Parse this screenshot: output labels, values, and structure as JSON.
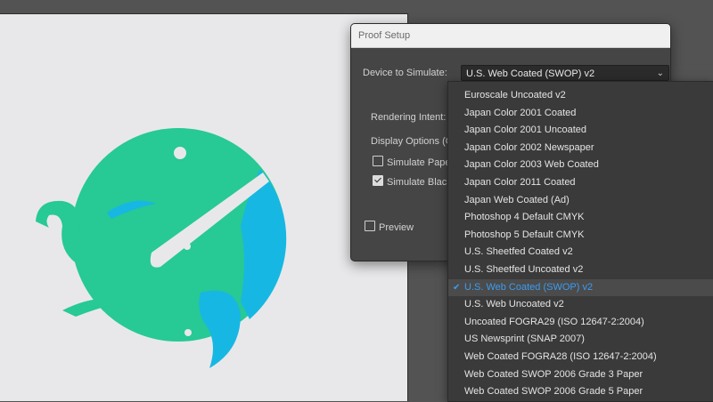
{
  "dialog": {
    "title": "Proof Setup",
    "device_label": "Device to Simulate:",
    "device_value": "U.S. Web Coated (SWOP) v2",
    "rendering_intent_label": "Rendering Intent:",
    "display_options_label": "Display Options (C",
    "simulate_paper_label": "Simulate Paper",
    "simulate_black_label": "Simulate Black",
    "simulate_paper_checked": false,
    "simulate_black_checked": true,
    "preview_label": "Preview",
    "preview_checked": false
  },
  "dropdown": {
    "selected_index": 11,
    "options": [
      "Euroscale Uncoated v2",
      "Japan Color 2001 Coated",
      "Japan Color 2001 Uncoated",
      "Japan Color 2002 Newspaper",
      "Japan Color 2003 Web Coated",
      "Japan Color 2011 Coated",
      "Japan Web Coated (Ad)",
      "Photoshop 4 Default CMYK",
      "Photoshop 5 Default CMYK",
      "U.S. Sheetfed Coated v2",
      "U.S. Sheetfed Uncoated v2",
      "U.S. Web Coated (SWOP) v2",
      "U.S. Web Uncoated v2",
      "Uncoated FOGRA29 (ISO 12647-2:2004)",
      "US Newsprint (SNAP 2007)",
      "Web Coated FOGRA28 (ISO 12647-2:2004)",
      "Web Coated SWOP 2006 Grade 3 Paper",
      "Web Coated SWOP 2006 Grade 5 Paper"
    ]
  },
  "colors": {
    "accent": "#3c9cf0",
    "art_green": "#27c995",
    "art_blue": "#17b7e3"
  }
}
